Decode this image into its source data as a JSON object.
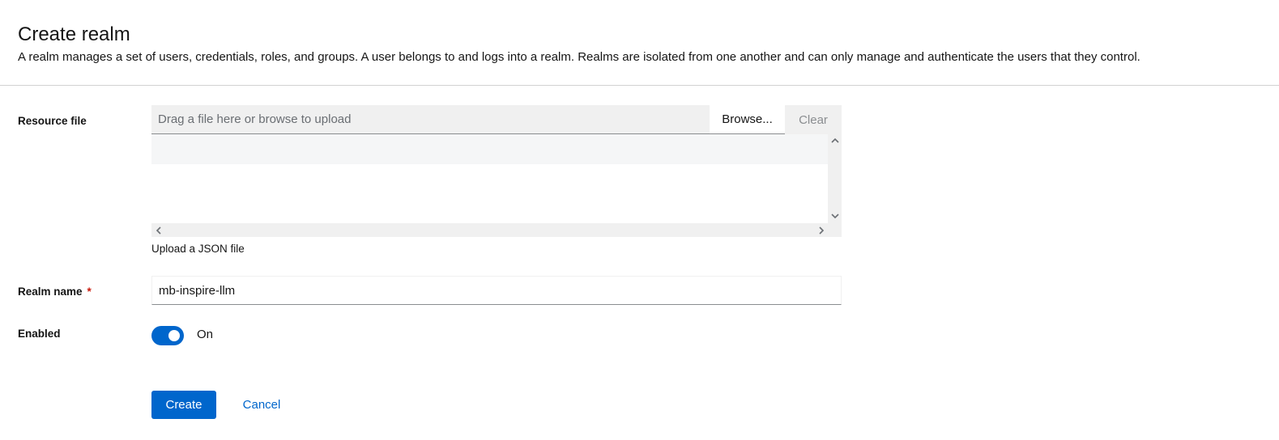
{
  "header": {
    "title": "Create realm",
    "description": "A realm manages a set of users, credentials, roles, and groups. A user belongs to and logs into a realm. Realms are isolated from one another and can only manage and authenticate the users that they control."
  },
  "form": {
    "resource_file": {
      "label": "Resource file",
      "placeholder": "Drag a file here or browse to upload",
      "browse_label": "Browse...",
      "clear_label": "Clear",
      "helper_text": "Upload a JSON file",
      "icons": {
        "scroll_up": "chevron-up-icon",
        "scroll_down": "chevron-down-icon",
        "scroll_left": "chevron-left-icon",
        "scroll_right": "chevron-right-icon"
      }
    },
    "realm_name": {
      "label": "Realm name",
      "required_marker": "*",
      "value": "mb-inspire-llm"
    },
    "enabled": {
      "label": "Enabled",
      "state_label": "On",
      "checked": true
    }
  },
  "actions": {
    "create_label": "Create",
    "cancel_label": "Cancel"
  },
  "colors": {
    "primary": "#0066cc",
    "required": "#c9190b",
    "text": "#151515",
    "muted": "#6a6e73",
    "field_bg": "#f0f0f0"
  }
}
